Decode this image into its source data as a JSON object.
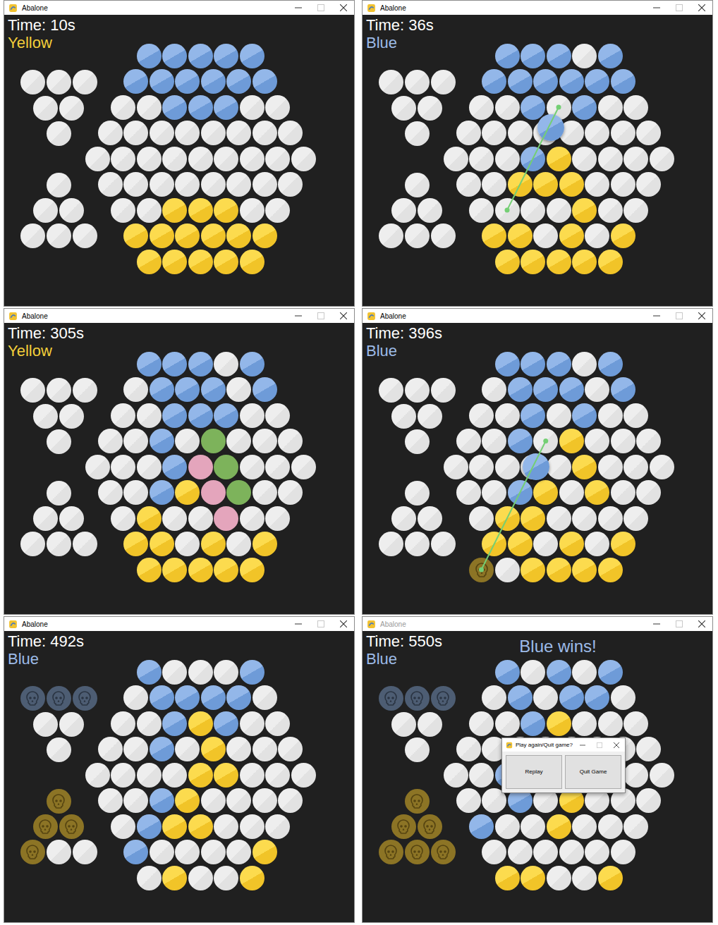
{
  "screens": [
    {
      "window": {
        "title": "Abalone",
        "active": true
      },
      "time": "Time: 10s",
      "turn": {
        "label": "Yellow",
        "color": "#f3cf3a"
      },
      "board": [
        "bbbbb",
        "bbbbbb",
        "eebbbee",
        "eeeeeeee",
        "eeeeeeeee",
        "eeeeeeee",
        "eeyyyee",
        "yyyyyy",
        "yyyyy"
      ],
      "trays": {
        "top": [
          "eee",
          "ee",
          "e"
        ],
        "bottom": [
          "e",
          "ee",
          "eee"
        ]
      }
    },
    {
      "window": {
        "title": "Abalone",
        "active": true
      },
      "time": "Time: 36s",
      "turn": {
        "label": "Blue",
        "color": "#9dbbe8"
      },
      "board": [
        "bbbeb",
        "bbbbbb",
        "eebebee",
        "eeeeeeee",
        "eeebyeeee",
        "eeyyyeee",
        "eeeeyee",
        "yyeyey",
        "yyyyy"
      ],
      "trays": {
        "top": [
          "eee",
          "ee",
          "e"
        ],
        "bottom": [
          "e",
          "ee",
          "eee"
        ]
      },
      "drag": {
        "from": [
          6,
          1
        ],
        "to": [
          2,
          3
        ],
        "marble": "b"
      }
    },
    {
      "window": {
        "title": "Abalone",
        "active": true
      },
      "time": "Time: 305s",
      "turn": {
        "label": "Yellow",
        "color": "#f3cf3a"
      },
      "board": [
        "bbbeb",
        "ebbbeb",
        "eebbbee",
        "eebegeee",
        "eeebpgeee",
        "eebypgee",
        "eyeepee",
        "yyeyey",
        "yyyyy"
      ],
      "trays": {
        "top": [
          "eee",
          "ee",
          "e"
        ],
        "bottom": [
          "e",
          "ee",
          "eee"
        ]
      }
    },
    {
      "window": {
        "title": "Abalone",
        "active": true
      },
      "time": "Time: 396s",
      "turn": {
        "label": "Blue",
        "color": "#9dbbe8"
      },
      "board": [
        "bbbeb",
        "ebbbeb",
        "eebebee",
        "eebeyeee",
        "eeeeeyeee",
        "eebyeyee",
        "eyyeeee",
        "yyeyey",
        "eyyyy"
      ],
      "trays": {
        "top": [
          "eee",
          "ee",
          "e"
        ],
        "bottom": [
          "e",
          "ee",
          "eee"
        ]
      },
      "drag": {
        "from": [
          8,
          -1
        ],
        "to": [
          3,
          3
        ],
        "marble": "b",
        "from_mark": "Y"
      }
    },
    {
      "window": {
        "title": "Abalone",
        "active": true
      },
      "time": "Time: 492s",
      "turn": {
        "label": "Blue",
        "color": "#9dbbe8"
      },
      "board": [
        "beeeb",
        "ebbbbe",
        "eebybee",
        "eebeyeee",
        "eeeeyyeee",
        "eebyeeee",
        "ebyyeee",
        "beeeey",
        "eyeey"
      ],
      "trays": {
        "top": [
          "BBB",
          "ee",
          "e"
        ],
        "bottom": [
          "Y",
          "YY",
          "Yee"
        ]
      }
    },
    {
      "window": {
        "title": "Abalone",
        "active": false
      },
      "time": "Time: 550s",
      "turn": {
        "label": "Blue",
        "color": "#9dbbe8"
      },
      "winner": {
        "label": "Blue wins!",
        "color": "#9dbbe8"
      },
      "board": [
        "bebeb",
        "ebebbe",
        "eebyeee",
        "eeeeeeee",
        "eebeeeeee",
        "eebeyeee",
        "beeyeee",
        "eeeeee",
        "yyeey"
      ],
      "trays": {
        "top": [
          "BBB",
          "ee",
          "e"
        ],
        "bottom": [
          "Y",
          "YY",
          "YYY"
        ]
      },
      "dialog": {
        "title": "Play again/Quit game?",
        "buttons": [
          "Replay",
          "Quit Game"
        ]
      }
    }
  ]
}
